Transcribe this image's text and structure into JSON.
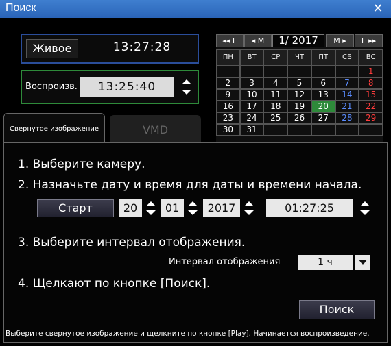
{
  "window": {
    "title": "Поиск"
  },
  "live": {
    "label": "Живое",
    "time": "13:27:28"
  },
  "playback": {
    "label": "Воспроизв.",
    "time": "13:25:40"
  },
  "calendar": {
    "nav": {
      "prev_year": "◂◂ Г",
      "prev_month": "◂ М",
      "next_month": "М ▸",
      "next_year": "Г ▸▸"
    },
    "month_year": "1/ 2017",
    "weekdays": [
      "ПН",
      "ВТ",
      "СР",
      "ЧТ",
      "ПТ",
      "СБ",
      "ВС"
    ],
    "weeks": [
      [
        "",
        "",
        "",
        "",
        "",
        "",
        "1"
      ],
      [
        "2",
        "3",
        "4",
        "5",
        "6",
        "7",
        "8"
      ],
      [
        "9",
        "10",
        "11",
        "12",
        "13",
        "14",
        "15"
      ],
      [
        "16",
        "17",
        "18",
        "19",
        "20",
        "21",
        "22"
      ],
      [
        "23",
        "24",
        "25",
        "26",
        "27",
        "28",
        "29"
      ],
      [
        "30",
        "31",
        "",
        "",
        "",
        "",
        ""
      ]
    ],
    "selected_day": "20",
    "colors": {
      "saturday": "#5a8cff",
      "sunday": "#ff3c3c",
      "selected": "#2e8a3a"
    }
  },
  "tabs": [
    {
      "label": "Свернутое изображение",
      "active": true
    },
    {
      "label": "VMD",
      "active": false
    }
  ],
  "steps": {
    "s1": "1. Выберите камеру.",
    "s2": "2. Назначьте дату и время для даты и времени начала.",
    "s3": "3. Выберите интервал отображения.",
    "s4": "4. Щелкают по кнопке [Поиск]."
  },
  "start": {
    "button": "Старт",
    "day": "20",
    "month": "01",
    "year": "2017",
    "time": "01:27:25"
  },
  "interval": {
    "label": "Интервал отображения",
    "value": "1 ч"
  },
  "search_button": "Поиск",
  "footer": "Выберите свернутое изображение и щелкните по кнопке [Play]. Начинается воспроизведение."
}
